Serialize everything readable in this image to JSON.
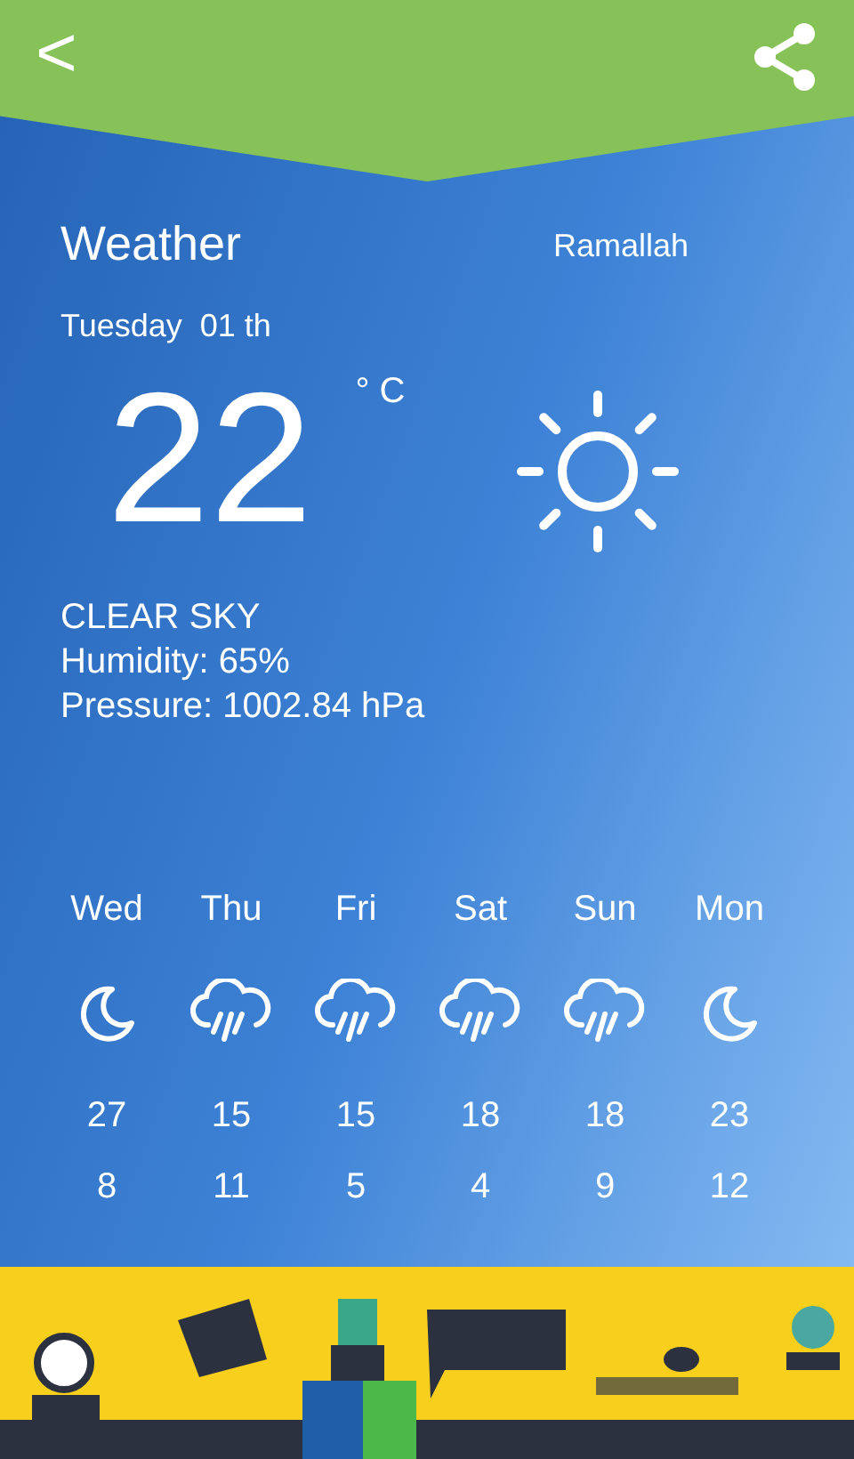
{
  "header": {
    "back": "<"
  },
  "current": {
    "title": "Weather",
    "city": "Ramallah",
    "date": "Tuesday  01 th",
    "temperature": "22",
    "unit": "° C",
    "kind": "sun",
    "condition": "CLEAR SKY",
    "humidity": "Humidity: 65%",
    "pressure": "Pressure: 1002.84 hPa"
  },
  "forecast": [
    {
      "day": "Wed",
      "kind": "moon",
      "high": "27",
      "low": "8"
    },
    {
      "day": "Thu",
      "kind": "rain",
      "high": "15",
      "low": "11"
    },
    {
      "day": "Fri",
      "kind": "rain",
      "high": "15",
      "low": "5"
    },
    {
      "day": "Sat",
      "kind": "rain",
      "high": "18",
      "low": "4"
    },
    {
      "day": "Sun",
      "kind": "rain",
      "high": "18",
      "low": "9"
    },
    {
      "day": "Mon",
      "kind": "moon",
      "high": "23",
      "low": "12"
    }
  ]
}
